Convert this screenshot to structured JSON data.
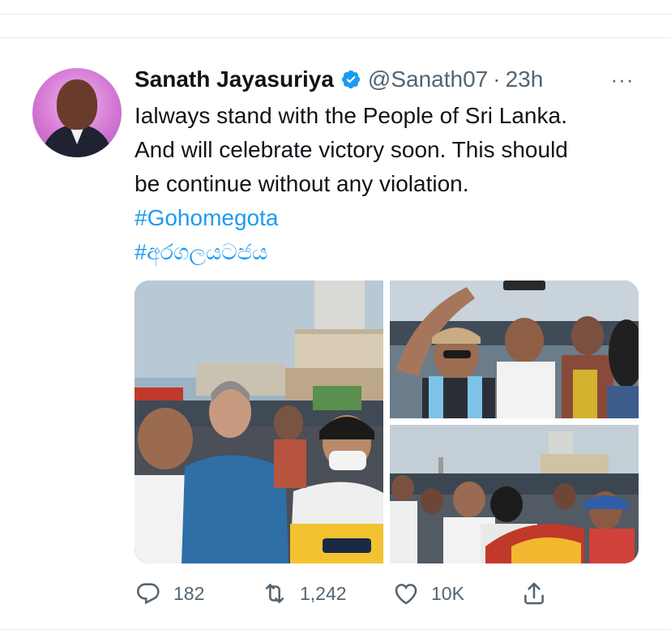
{
  "tweet": {
    "author_name": "Sanath Jayasuriya",
    "handle": "@Sanath07",
    "separator": "·",
    "time": "23h",
    "more_label": "···",
    "text_lines": [
      "Ialways stand with the People of Sri Lanka.",
      "And will celebrate victory soon. This should",
      "be continue without any violation."
    ],
    "hashtags": [
      "#Gohomegota",
      "#අරගලයටජය"
    ],
    "colors": {
      "link": "#1d9bf0",
      "verified": "#1d9bf0",
      "muted": "#536471"
    }
  },
  "actions": {
    "reply_count": "182",
    "retweet_count": "1,242",
    "like_count": "10K"
  },
  "icons": [
    "verified-badge-icon",
    "more-icon",
    "reply-icon",
    "retweet-icon",
    "like-icon",
    "share-icon"
  ]
}
